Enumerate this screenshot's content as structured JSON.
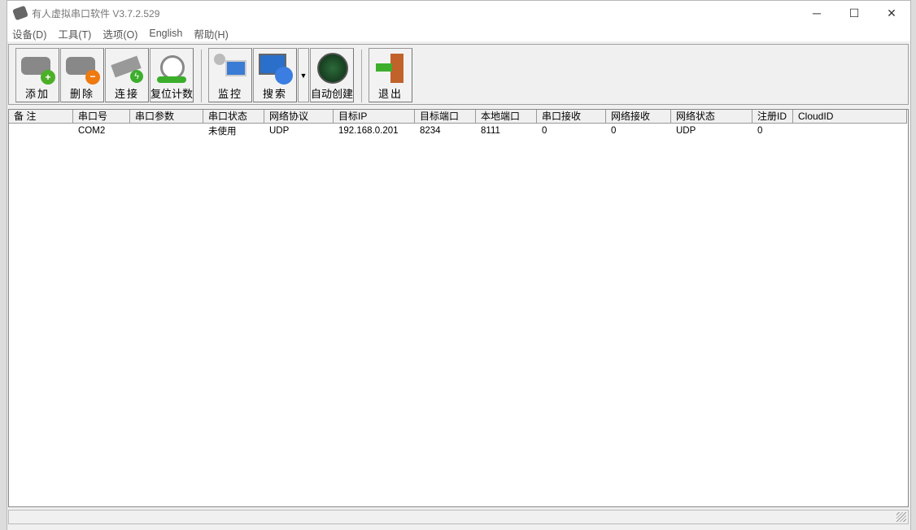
{
  "window": {
    "title": "有人虚拟串口软件 V3.7.2.529",
    "minimize": "─",
    "maximize": "☐",
    "close": "✕"
  },
  "menu": [
    "设备(D)",
    "工具(T)",
    "选项(O)",
    "English",
    "帮助(H)"
  ],
  "toolbar": {
    "add": "添加",
    "delete": "删除",
    "connect": "连接",
    "reset": "复位计数",
    "monitor": "监控",
    "search": "搜索",
    "dropdown": "▼",
    "auto": "自动创建",
    "exit": "退出"
  },
  "table": {
    "headers": [
      "备 注",
      "串口号",
      "串口参数",
      "串口状态",
      "网络协议",
      "目标IP",
      "目标端口",
      "本地端口",
      "串口接收",
      "网络接收",
      "网络状态",
      "注册ID",
      "CloudID"
    ],
    "rows": [
      [
        "",
        "COM2",
        "",
        "未使用",
        "UDP",
        "192.168.0.201",
        "8234",
        "8111",
        "0",
        "0",
        "UDP",
        "0",
        ""
      ]
    ]
  }
}
